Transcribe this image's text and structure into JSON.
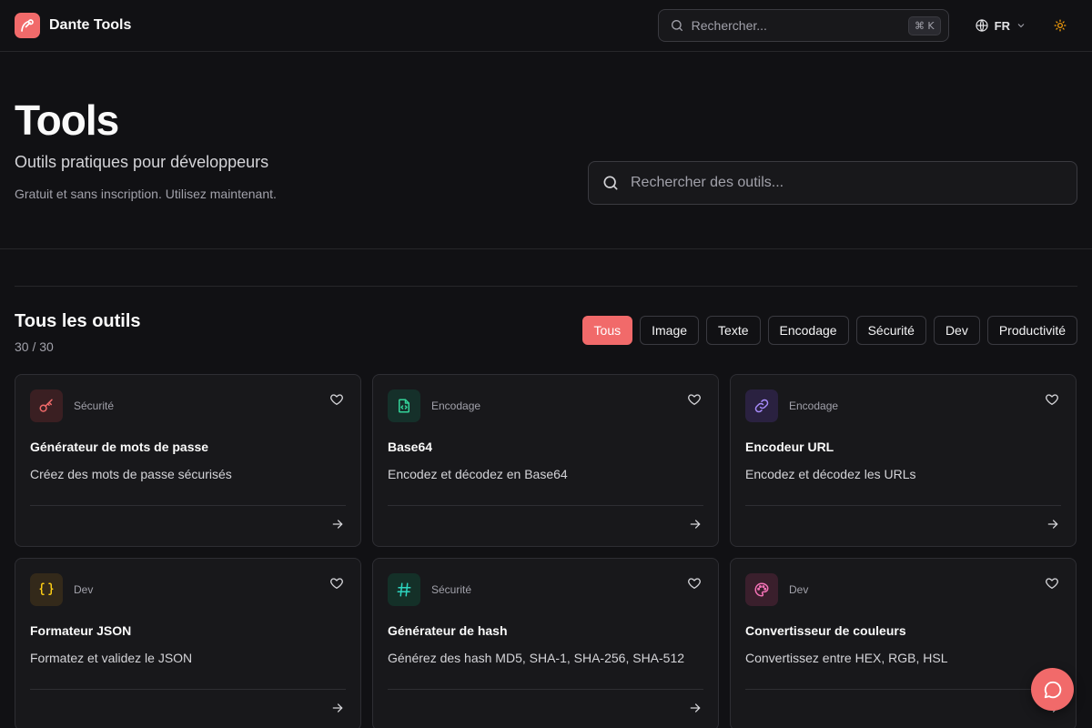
{
  "app": {
    "name": "Dante Tools"
  },
  "nav": {
    "search_placeholder": "Rechercher...",
    "shortcut": "⌘ K",
    "language": "FR"
  },
  "hero": {
    "title": "Tools",
    "subtitle": "Outils pratiques pour développeurs",
    "note": "Gratuit et sans inscription. Utilisez maintenant.",
    "search_placeholder": "Rechercher des outils..."
  },
  "section": {
    "title": "Tous les outils",
    "count": "30 / 30"
  },
  "filters": [
    {
      "label": "Tous",
      "active": true
    },
    {
      "label": "Image",
      "active": false
    },
    {
      "label": "Texte",
      "active": false
    },
    {
      "label": "Encodage",
      "active": false
    },
    {
      "label": "Sécurité",
      "active": false
    },
    {
      "label": "Dev",
      "active": false
    },
    {
      "label": "Productivité",
      "active": false
    }
  ],
  "tools": [
    {
      "category": "Sécurité",
      "title": "Générateur de mots de passe",
      "description": "Créez des mots de passe sécurisés",
      "icon": "key-icon",
      "color": "#f16a6a",
      "bg": "#3a1f22"
    },
    {
      "category": "Encodage",
      "title": "Base64",
      "description": "Encodez et décodez en Base64",
      "icon": "file-code-icon",
      "color": "#34d399",
      "bg": "#15302a"
    },
    {
      "category": "Encodage",
      "title": "Encodeur URL",
      "description": "Encodez et décodez les URLs",
      "icon": "link-icon",
      "color": "#a78bfa",
      "bg": "#2a2140"
    },
    {
      "category": "Dev",
      "title": "Formateur JSON",
      "description": "Formatez et validez le JSON",
      "icon": "braces-icon",
      "color": "#facc15",
      "bg": "#33291a"
    },
    {
      "category": "Sécurité",
      "title": "Générateur de hash",
      "description": "Générez des hash MD5, SHA-1, SHA-256, SHA-512",
      "icon": "hash-icon",
      "color": "#2dd4bf",
      "bg": "#143028"
    },
    {
      "category": "Dev",
      "title": "Convertisseur de couleurs",
      "description": "Convertissez entre HEX, RGB, HSL",
      "icon": "palette-icon",
      "color": "#f472b6",
      "bg": "#3a1f2c"
    }
  ],
  "colors": {
    "accent": "#f16a6a",
    "background": "#111114",
    "card": "#18181b"
  }
}
